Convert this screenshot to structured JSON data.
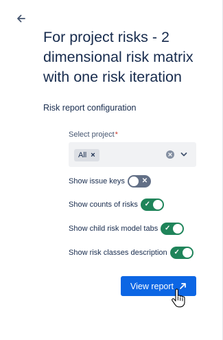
{
  "header": {
    "back_icon": "arrow-left-icon"
  },
  "page": {
    "title": "For project risks - 2 dimensional risk matrix with one risk iteration"
  },
  "config": {
    "section_label": "Risk report configuration",
    "select_project": {
      "label": "Select project",
      "required_mark": "*",
      "chip_label": "All",
      "chip_remove": "×"
    },
    "toggles": [
      {
        "label": "Show issue keys",
        "state": "off"
      },
      {
        "label": "Show counts of risks",
        "state": "on"
      },
      {
        "label": "Show child risk model tabs",
        "state": "on"
      },
      {
        "label": "Show risk classes description",
        "state": "on"
      }
    ],
    "view_button": {
      "label": "View report",
      "icon": "external-arrow-icon"
    }
  },
  "colors": {
    "primary": "#0c66e4",
    "toggle_on": "#1f845a",
    "toggle_off": "#626f86",
    "text": "#172b4d"
  }
}
